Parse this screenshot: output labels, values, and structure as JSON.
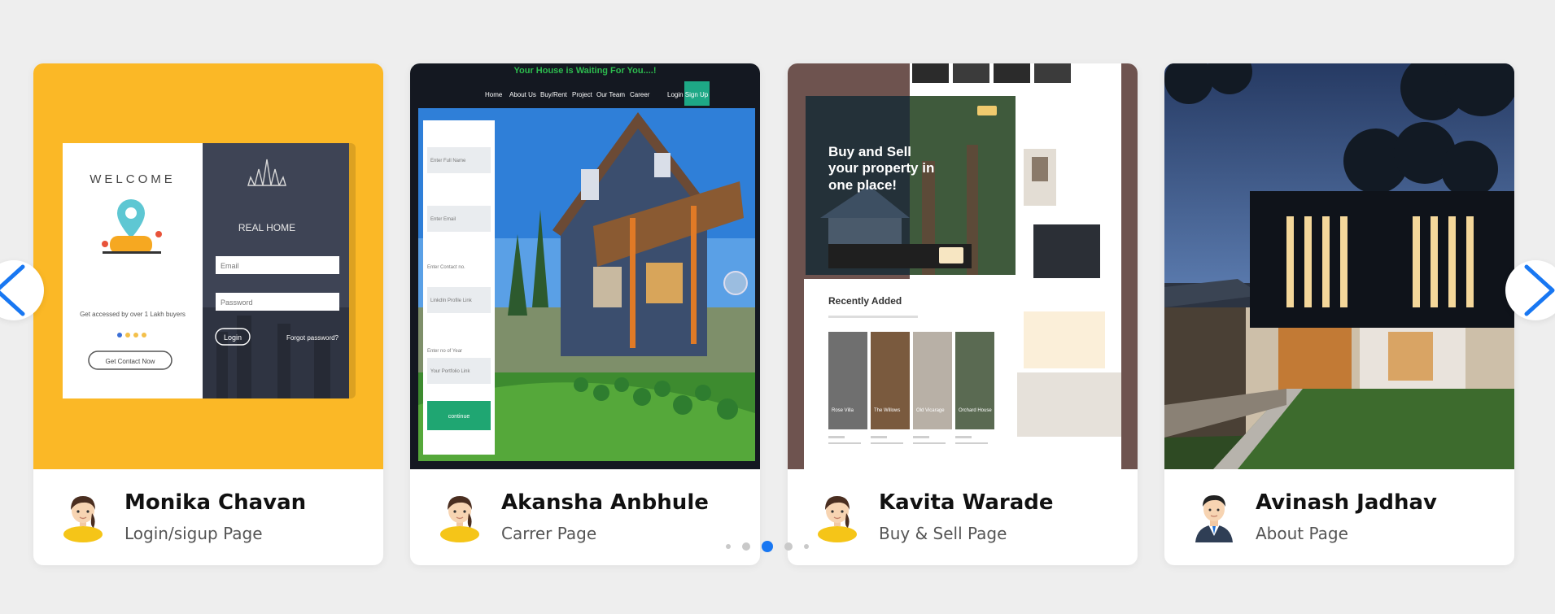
{
  "carousel": {
    "accent_color": "#1877f2",
    "prev_icon": "chevron-left-icon",
    "next_icon": "chevron-right-icon",
    "active_dot_index": 2,
    "cards": [
      {
        "name": "Monika Chavan",
        "role": "Login/sigup Page",
        "avatar_icon": "female-avatar-icon",
        "preview": {
          "welcome": "WELCOME",
          "brand": "REAL HOME",
          "email_placeholder": "Email",
          "password_placeholder": "Password",
          "login": "Login",
          "forgot": "Forgot password?",
          "tagline": "Get accessed by over 1 Lakh buyers",
          "cta": "Get Contact Now"
        }
      },
      {
        "name": "Akansha Anbhule",
        "role": "Carrer Page",
        "avatar_icon": "female-avatar-icon",
        "preview": {
          "headline": "Your House is Waiting For You....!",
          "nav": [
            "Home",
            "About Us",
            "Buy/Rent",
            "Project",
            "Our Team",
            "Career",
            "Login",
            "Sign Up"
          ],
          "fields": [
            "Enter Full Name",
            "Enter Email",
            "Enter Contact no.",
            "LinkdIn Profile Link",
            "Enter no of Year",
            "Your Portfolio Link"
          ],
          "submit": "continue"
        }
      },
      {
        "name": "Kavita Warade",
        "role": "Buy & Sell Page",
        "avatar_icon": "female-avatar-icon",
        "preview": {
          "hero_lines": [
            "Buy and Sell",
            "your property in",
            "one place!"
          ],
          "recent": "Recently Added",
          "listings": [
            "Rose Villa",
            "The Willows",
            "Old Vicarage",
            "Orchard House"
          ]
        }
      },
      {
        "name": "Avinash Jadhav",
        "role": "About Page",
        "avatar_icon": "male-avatar-icon",
        "preview": {}
      }
    ]
  }
}
